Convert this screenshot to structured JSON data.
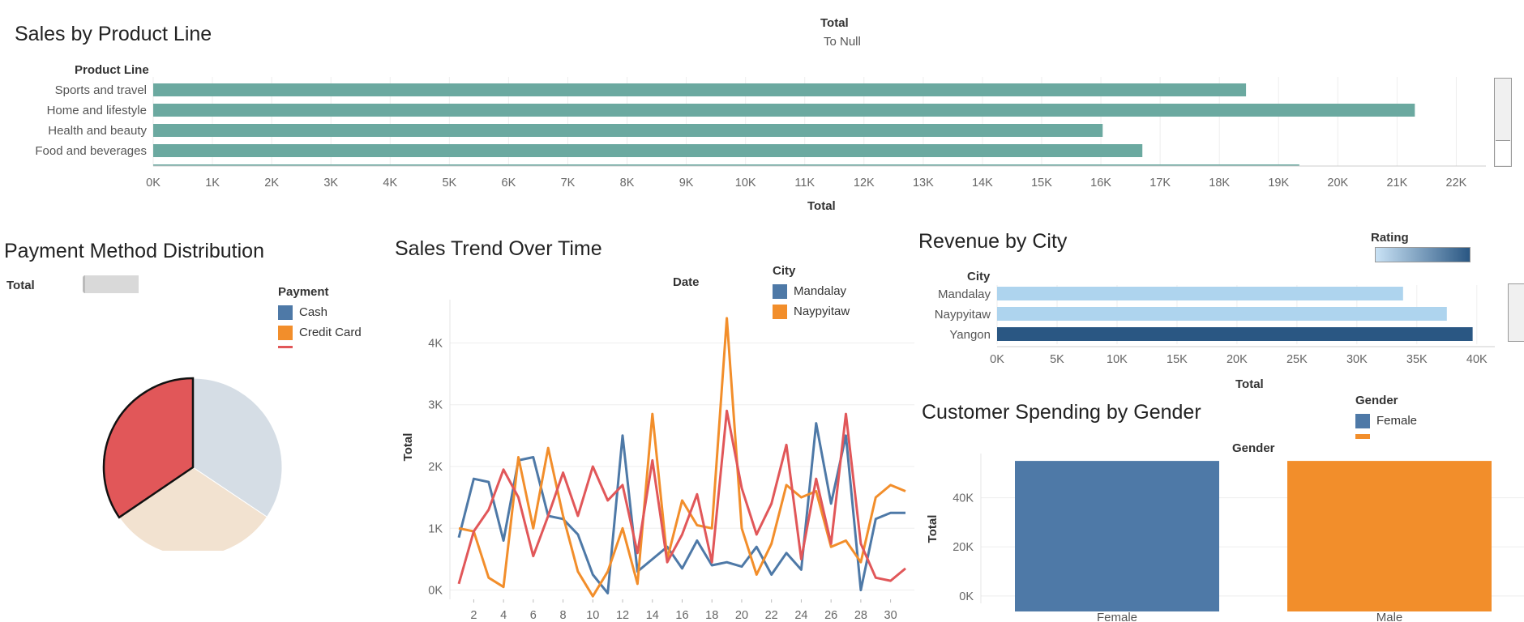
{
  "colors": {
    "teal": "#6BA9A0",
    "blue": "#4E79A7",
    "orange": "#F28E2B",
    "red": "#E15759",
    "pie_blue_light": "#D5DDE5",
    "pie_peach": "#F2E2D0",
    "light_blue": "#AED4EE",
    "dark_blue": "#2A5783",
    "grid": "#EEEEEE"
  },
  "sales_by_product": {
    "title": "Sales by Product Line",
    "filter_title": "Total",
    "filter_value": "To Null",
    "row_header": "Product Line",
    "x_title": "Total"
  },
  "payment": {
    "title": "Payment Method Distribution",
    "measure_label": "Total",
    "legend_title": "Payment",
    "legend_items": [
      "Cash",
      "Credit Card"
    ]
  },
  "trend": {
    "title": "Sales Trend Over Time",
    "column_header": "Date",
    "y_title": "Total",
    "legend_title": "City",
    "legend_items": [
      "Mandalay",
      "Naypyitaw"
    ]
  },
  "revenue_city": {
    "title": "Revenue by City",
    "legend_title": "Rating",
    "row_header": "City",
    "x_title": "Total"
  },
  "gender": {
    "title": "Customer Spending by Gender",
    "legend_title": "Gender",
    "legend_items": [
      "Female"
    ],
    "column_header": "Gender",
    "y_title": "Total"
  },
  "chart_data": [
    {
      "type": "bar",
      "orientation": "horizontal",
      "title": "Sales by Product Line",
      "categories": [
        "Sports and travel",
        "Home and lifestyle",
        "Health and beauty",
        "Food and beverages"
      ],
      "values": [
        18450,
        21300,
        16030,
        16700
      ],
      "partial_value": 19350,
      "xlabel": "Total",
      "xlim": [
        0,
        22500
      ],
      "xticks": [
        "0K",
        "1K",
        "2K",
        "3K",
        "4K",
        "5K",
        "6K",
        "7K",
        "8K",
        "9K",
        "10K",
        "11K",
        "12K",
        "13K",
        "14K",
        "15K",
        "16K",
        "17K",
        "18K",
        "19K",
        "20K",
        "21K",
        "22K"
      ]
    },
    {
      "type": "pie",
      "title": "Payment Method Distribution",
      "slices": [
        {
          "value": 0.344,
          "color": "#D5DDE5"
        },
        {
          "value": 0.311,
          "color": "#F2E2D0"
        },
        {
          "value": 0.345,
          "color": "#E15759"
        }
      ]
    },
    {
      "type": "line",
      "title": "Sales Trend Over Time",
      "ylabel": "Total",
      "ylim": [
        -150,
        4700
      ],
      "yticks": [
        "0K",
        "1K",
        "2K",
        "3K",
        "4K"
      ],
      "xticks": [
        "2",
        "4",
        "6",
        "8",
        "10",
        "12",
        "14",
        "16",
        "18",
        "20",
        "22",
        "24",
        "26",
        "28",
        "30"
      ],
      "x": [
        1,
        2,
        3,
        4,
        5,
        6,
        7,
        8,
        9,
        10,
        11,
        12,
        13,
        14,
        15,
        16,
        17,
        18,
        19,
        20,
        21,
        22,
        23,
        24,
        25,
        26,
        27,
        28,
        29,
        30,
        31
      ],
      "series": [
        {
          "name": "Mandalay",
          "color": "#4E79A7",
          "values": [
            850,
            1800,
            1750,
            800,
            2100,
            2150,
            1200,
            1150,
            900,
            250,
            -50,
            2500,
            300,
            500,
            700,
            350,
            800,
            400,
            450,
            380,
            700,
            250,
            600,
            330,
            2700,
            1400,
            2500,
            0,
            1150,
            1250,
            1250
          ]
        },
        {
          "name": "Naypyitaw",
          "color": "#F28E2B",
          "values": [
            1000,
            950,
            200,
            50,
            2150,
            1000,
            2300,
            1200,
            300,
            -100,
            300,
            1000,
            100,
            2850,
            500,
            1450,
            1050,
            1000,
            4400,
            1000,
            250,
            750,
            1700,
            1500,
            1600,
            700,
            800,
            450,
            1500,
            1700,
            1600
          ]
        },
        {
          "color": "#E15759",
          "values": [
            100,
            950,
            1300,
            1950,
            1500,
            550,
            1200,
            1900,
            1200,
            2000,
            1450,
            1700,
            600,
            2100,
            450,
            900,
            1550,
            450,
            2900,
            1650,
            900,
            1400,
            2350,
            500,
            1800,
            750,
            2850,
            750,
            200,
            150,
            350
          ]
        }
      ]
    },
    {
      "type": "bar",
      "orientation": "horizontal",
      "title": "Revenue by City",
      "categories": [
        "Mandalay",
        "Naypyitaw",
        "Yangon"
      ],
      "values": [
        33850,
        37500,
        39650
      ],
      "xlabel": "Total",
      "xlim": [
        0,
        41500
      ],
      "xticks": [
        "0K",
        "5K",
        "10K",
        "15K",
        "20K",
        "25K",
        "30K",
        "35K",
        "40K"
      ]
    },
    {
      "type": "bar",
      "title": "Customer Spending by Gender",
      "categories": [
        "Female",
        "Male"
      ],
      "values": [
        55000,
        55000
      ],
      "ylabel": "Total",
      "ylim": [
        -3000,
        58000
      ],
      "yticks": [
        "0K",
        "20K",
        "40K"
      ]
    }
  ]
}
